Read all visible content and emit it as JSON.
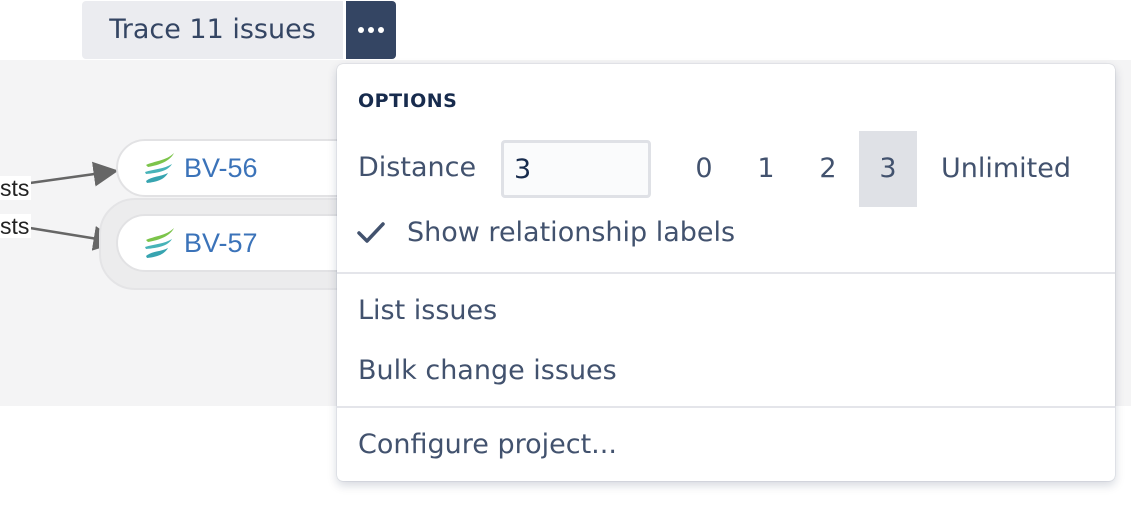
{
  "toolbar": {
    "trace_label": "Trace 11 issues",
    "more_icon": "ellipsis-icon"
  },
  "graph": {
    "edge_labels": [
      "sts",
      "sts"
    ],
    "nodes": [
      {
        "key": "BV-56",
        "icon": "issue-type-icon"
      },
      {
        "key": "BV-57",
        "icon": "issue-type-icon"
      }
    ]
  },
  "menu": {
    "heading": "OPTIONS",
    "distance": {
      "label": "Distance",
      "value": "3",
      "options": [
        "0",
        "1",
        "2",
        "3",
        "Unlimited"
      ],
      "selected": "3"
    },
    "show_labels": {
      "label": "Show relationship labels",
      "checked": true
    },
    "items": [
      "List issues",
      "Bulk change issues",
      "Configure project..."
    ]
  },
  "colors": {
    "accent_dark": "#344563",
    "link": "#3b73b9",
    "text": "#42526e",
    "heading": "#172b4d"
  }
}
